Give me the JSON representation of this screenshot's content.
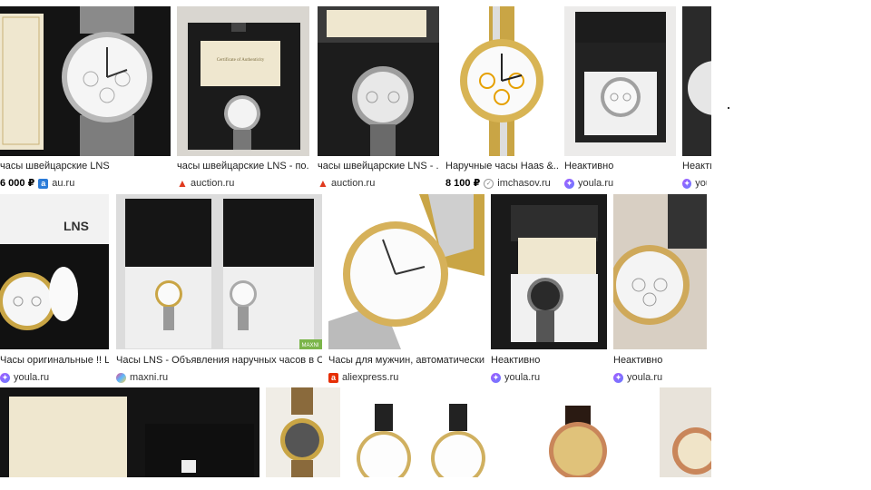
{
  "results": [
    {
      "caption": "часы швейцарские LNS",
      "price": "6 000 ₽",
      "source": "au.ru",
      "icon": "au-icon"
    },
    {
      "caption": "часы швейцарские LNS - по...",
      "price": "",
      "source": "auction.ru",
      "icon": "auction-icon"
    },
    {
      "caption": "часы швейцарские LNS - ...",
      "price": "",
      "source": "auction.ru",
      "icon": "auction-icon"
    },
    {
      "caption": "Наручные часы Haas &...",
      "price": "8 100 ₽",
      "source": "imchasov.ru",
      "icon": "imchasov-icon"
    },
    {
      "caption": "Неактивно",
      "price": "",
      "source": "youla.ru",
      "icon": "youla-icon"
    },
    {
      "caption": "Неакти",
      "price": "",
      "source": "you",
      "icon": "youla-icon"
    },
    {
      "caption": "Часы оригинальные !! L...",
      "price": "",
      "source": "youla.ru",
      "icon": "youla-icon"
    },
    {
      "caption": "Часы LNS - Объявления наручных часов в Сочи",
      "price": "",
      "source": "maxni.ru",
      "icon": "maxni-icon"
    },
    {
      "caption": "Часы для мужчин, автоматические...",
      "price": "",
      "source": "aliexpress.ru",
      "icon": "aliexpress-icon"
    },
    {
      "caption": "Неактивно",
      "price": "",
      "source": "youla.ru",
      "icon": "youla-icon"
    },
    {
      "caption": "Неактивно",
      "price": "",
      "source": "youla.ru",
      "icon": "youla-icon"
    }
  ],
  "thumb_text": {
    "certificate": "Certificate of Authenticity",
    "brand": "LNS",
    "sale_badge": "MAXNI"
  },
  "colors": {
    "youla": "#8a5cff",
    "auction": "#e03a1e",
    "au": "#2a7bd8",
    "ali": "#e62e04"
  }
}
